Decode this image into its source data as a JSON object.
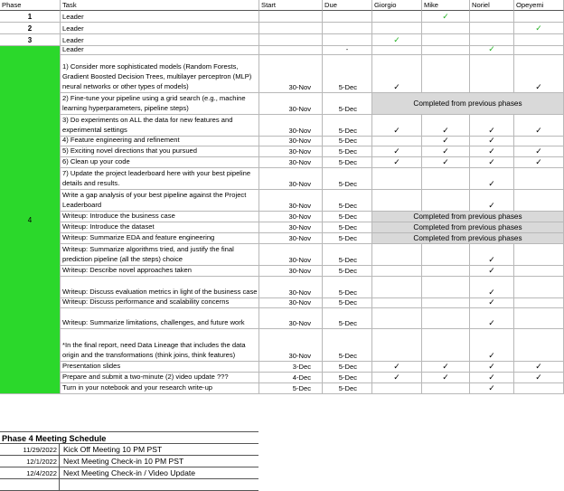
{
  "headers": [
    "Phase",
    "Task",
    "Start",
    "Due",
    "Giorgio",
    "Mike",
    "Noriel",
    "Opeyemi"
  ],
  "colors": {
    "phase4_green": "#2bd82b",
    "check_green": "#21b021",
    "merged_gray": "#d9d9d9"
  },
  "top_rows": [
    {
      "phase": "1",
      "task": "Leader",
      "marks": [
        "",
        "✓",
        "",
        ""
      ]
    },
    {
      "phase": "2",
      "task": "Leader",
      "marks": [
        "",
        "",
        "",
        "✓"
      ]
    },
    {
      "phase": "3",
      "task": "Leader",
      "marks": [
        "✓",
        "",
        "",
        ""
      ]
    }
  ],
  "phase4": {
    "label": "4",
    "leader_row": {
      "task": "Leader",
      "due": "-",
      "marks": [
        "",
        "",
        "✓",
        ""
      ]
    },
    "rows": [
      {
        "task": "1) Consider more sophisticated models (Random Forests, Gradient Boosted Decision Trees, multilayer perceptron (MLP) neural networks or other types of models)",
        "start": "30-Nov",
        "due": "5-Dec",
        "marks": [
          "✓",
          "",
          "",
          "✓"
        ]
      },
      {
        "task": "2) Fine-tune your pipeline using a grid search (e.g., machine learning hyperparameters, pipeline steps)",
        "start": "30-Nov",
        "due": "5-Dec",
        "merged": "Completed from previous phases"
      },
      {
        "task": "3) Do experiments on ALL the data for new features and experimental settings",
        "start": "30-Nov",
        "due": "5-Dec",
        "marks": [
          "✓",
          "✓",
          "✓",
          "✓"
        ]
      },
      {
        "task": "4) Feature engineering and refinement",
        "start": "30-Nov",
        "due": "5-Dec",
        "marks": [
          "",
          "✓",
          "✓",
          ""
        ]
      },
      {
        "task": "5) Exciting novel directions that you pursued",
        "start": "30-Nov",
        "due": "5-Dec",
        "marks": [
          "✓",
          "✓",
          "✓",
          "✓"
        ]
      },
      {
        "task": "6) Clean up your code",
        "start": "30-Nov",
        "due": "5-Dec",
        "marks": [
          "✓",
          "✓",
          "✓",
          "✓"
        ]
      },
      {
        "task": "7) Update the project leaderboard here  with your best pipeline details and results.",
        "start": "30-Nov",
        "due": "5-Dec",
        "marks": [
          "",
          "",
          "✓",
          ""
        ]
      },
      {
        "task": "Write a gap analysis of your best pipeline against the Project Leaderboard",
        "start": "30-Nov",
        "due": "5-Dec",
        "marks": [
          "",
          "",
          "✓",
          ""
        ]
      },
      {
        "task": "Writeup: Introduce the business case",
        "start": "30-Nov",
        "due": "5-Dec",
        "merged": "Completed from previous phases"
      },
      {
        "task": "Writeup: Introduce the dataset",
        "start": "30-Nov",
        "due": "5-Dec",
        "merged": "Completed from previous phases"
      },
      {
        "task": "Writeup: Summarize EDA and feature engineering",
        "start": "30-Nov",
        "due": "5-Dec",
        "merged": "Completed from previous phases"
      },
      {
        "task": "Writeup: Summarize algorithms tried, and justify the final prediction pipeline (all the steps) choice",
        "start": "30-Nov",
        "due": "5-Dec",
        "marks": [
          "",
          "",
          "✓",
          ""
        ]
      },
      {
        "task": "Writeup: Describe novel approaches taken",
        "start": "30-Nov",
        "due": "5-Dec",
        "marks": [
          "",
          "",
          "✓",
          ""
        ]
      },
      {
        "task": "Writeup: Discuss evaluation metrics in light of the business case",
        "start": "30-Nov",
        "due": "5-Dec",
        "marks": [
          "",
          "",
          "✓",
          ""
        ]
      },
      {
        "task": "Writeup: Discuss performance and scalability concerns",
        "start": "30-Nov",
        "due": "5-Dec",
        "marks": [
          "",
          "",
          "✓",
          ""
        ]
      },
      {
        "task": "Writeup: Summarize limitations, challenges, and future work",
        "start": "30-Nov",
        "due": "5-Dec",
        "marks": [
          "",
          "",
          "✓",
          ""
        ]
      },
      {
        "task": "*In the final report, need Data Lineage that includes the data origin and the transformations (think joins, think features)",
        "start": "30-Nov",
        "due": "5-Dec",
        "marks": [
          "",
          "",
          "✓",
          ""
        ]
      },
      {
        "task": "Presentation slides",
        "start": "3-Dec",
        "due": "5-Dec",
        "marks": [
          "✓",
          "✓",
          "✓",
          "✓"
        ]
      },
      {
        "task": "Prepare and submit a two-minute (2) video update ???",
        "start": "4-Dec",
        "due": "5-Dec",
        "marks": [
          "✓",
          "✓",
          "✓",
          "✓"
        ]
      },
      {
        "task": "Turn in your notebook and your research write-up",
        "start": "5-Dec",
        "due": "5-Dec",
        "marks": [
          "",
          "",
          "✓",
          ""
        ]
      }
    ]
  },
  "schedule": {
    "title": "Phase 4 Meeting Schedule",
    "rows": [
      {
        "date": "11/29/2022",
        "text": "Kick  Off Meeting 10 PM PST"
      },
      {
        "date": "12/1/2022",
        "text": "Next Meeting Check-in 10 PM PST"
      },
      {
        "date": "12/4/2022",
        "text": "Next Meeting Check-in / Video Update"
      }
    ]
  }
}
